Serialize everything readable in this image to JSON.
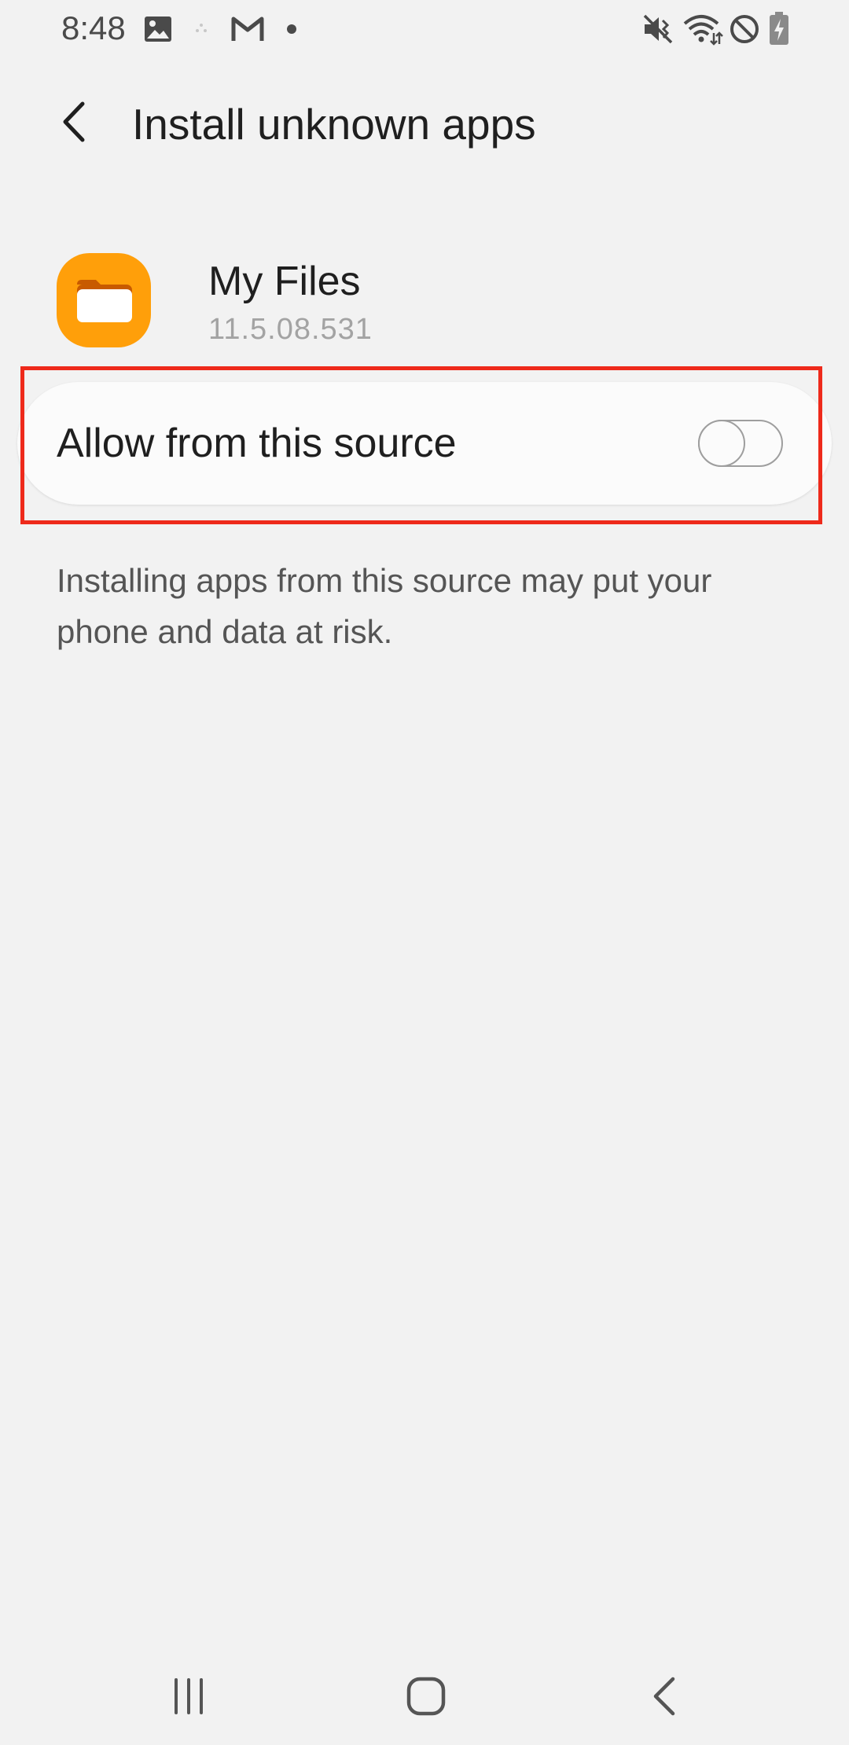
{
  "status_bar": {
    "time": "8:48",
    "left_icons": [
      "image-notification-icon",
      "sparkle-dot-icon",
      "gmail-icon",
      "notification-dot-icon"
    ],
    "right_icons": [
      "vibrate-mute-icon",
      "wifi-icon",
      "do-not-disturb-icon",
      "battery-charging-icon"
    ]
  },
  "header": {
    "title": "Install unknown apps",
    "back_icon": "chevron-left-icon"
  },
  "app": {
    "name": "My Files",
    "version": "11.5.08.531",
    "icon": "folder-icon",
    "icon_color": "#ff9f0a"
  },
  "setting": {
    "label": "Allow from this source",
    "toggle_on": false
  },
  "warning": {
    "text": "Installing apps from this source may put your phone and data at risk."
  },
  "nav_bar": {
    "buttons": [
      "recent-apps-icon",
      "home-icon",
      "back-icon"
    ]
  },
  "colors": {
    "background": "#f2f2f2",
    "card": "#fbfbfb",
    "highlight": "#ee2a1b",
    "accent_orange": "#ff9f0a"
  }
}
